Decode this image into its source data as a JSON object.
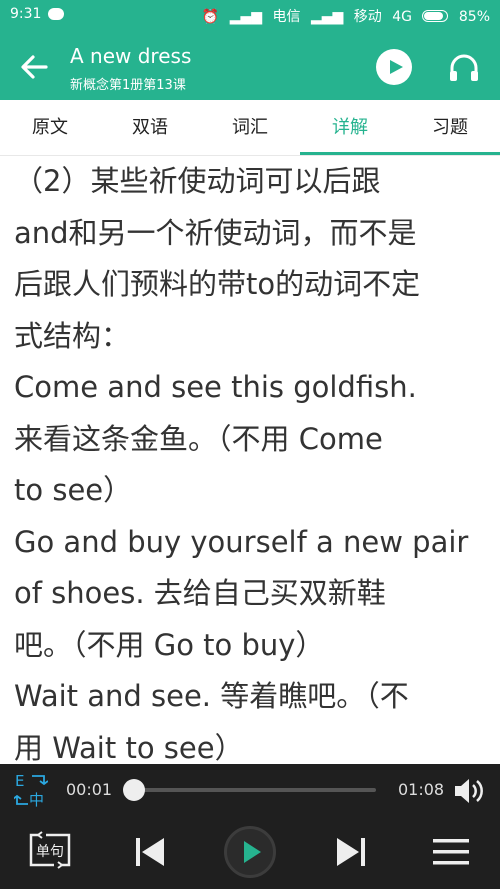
{
  "status_bar": {
    "time": "9:31",
    "nfc_badge": "NFC",
    "carrier1": "电信",
    "carrier2": "移动",
    "network": "4G",
    "battery": "85%"
  },
  "header": {
    "title": "A new dress",
    "subtitle": "新概念第1册第13课"
  },
  "tabs": [
    "原文",
    "双语",
    "词汇",
    "详解",
    "习题"
  ],
  "active_tab": "详解",
  "content_lines": [
    "（2）某些祈使动词可以后跟",
    "and和另一个祈使动词，而不是",
    "后跟人们预料的带to的动词不定",
    "式结构：",
    "Come and see this goldfish.",
    "来看这条金鱼。（不用 Come",
    "to see）",
    "Go and buy yourself a new pair",
    "of shoes.  去给自己买双新鞋",
    "吧。（不用 Go to buy）",
    "Wait and see.  等着瞧吧。（不",
    "用 Wait to see）"
  ],
  "player": {
    "current_time": "00:01",
    "total_time": "01:08",
    "progress_fraction": 0.0,
    "single_sentence_label": "单句",
    "lang_toggle_top": "E",
    "lang_toggle_bottom": "中"
  },
  "colors": {
    "accent": "#26b38f",
    "player_bg": "#1f1f1f",
    "text": "#333333"
  }
}
